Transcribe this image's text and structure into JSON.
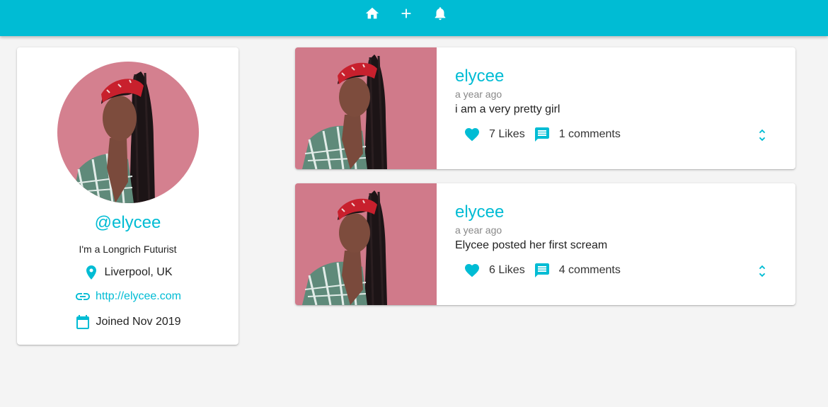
{
  "nav": {
    "home_icon": "home-icon",
    "add_icon": "add-icon",
    "notifications_icon": "bell-icon"
  },
  "colors": {
    "primary": "#00bcd4",
    "background": "#f4f4f4",
    "photo_backdrop": "#d4808f"
  },
  "profile": {
    "handle": "@elycee",
    "bio": "I'm a Longrich Futurist",
    "location": "Liverpool, UK",
    "website": "http://elycee.com",
    "joined": "Joined Nov 2019"
  },
  "posts": [
    {
      "user": "elycee",
      "time": "a year ago",
      "body": "i am a very pretty girl",
      "likes": "7 Likes",
      "comments": "1 comments"
    },
    {
      "user": "elycee",
      "time": "a year ago",
      "body": "Elycee posted her first scream",
      "likes": "6 Likes",
      "comments": "4 comments"
    }
  ]
}
